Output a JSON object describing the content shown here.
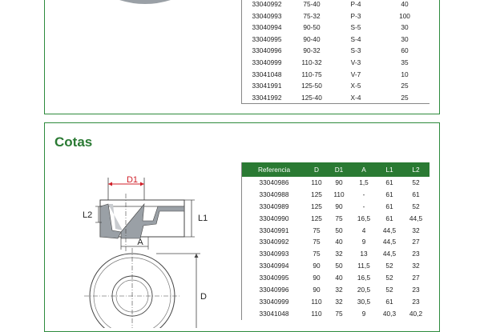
{
  "top_table": {
    "rows": [
      [
        "33040992",
        "75-40",
        "P-4",
        "40"
      ],
      [
        "33040993",
        "75-32",
        "P-3",
        "100"
      ],
      [
        "33040994",
        "90-50",
        "S-5",
        "30"
      ],
      [
        "33040995",
        "90-40",
        "S-4",
        "30"
      ],
      [
        "33040996",
        "90-32",
        "S-3",
        "60"
      ],
      [
        "33040999",
        "110-32",
        "V-3",
        "35"
      ],
      [
        "33041048",
        "110-75",
        "V-7",
        "10"
      ],
      [
        "33041991",
        "125-50",
        "X-5",
        "25"
      ],
      [
        "33041992",
        "125-40",
        "X-4",
        "25"
      ]
    ]
  },
  "cotas": {
    "title": "Cotas",
    "drawing_labels": {
      "d1": "D1",
      "l2": "L2",
      "l1": "L1",
      "a": "A",
      "d": "D"
    },
    "table": {
      "headers": [
        "Referencia",
        "D",
        "D1",
        "A",
        "L1",
        "L2"
      ],
      "rows": [
        [
          "33040986",
          "110",
          "90",
          "1,5",
          "61",
          "52"
        ],
        [
          "33040988",
          "125",
          "110",
          "-",
          "61",
          "61"
        ],
        [
          "33040989",
          "125",
          "90",
          "-",
          "61",
          "52"
        ],
        [
          "33040990",
          "125",
          "75",
          "16,5",
          "61",
          "44,5"
        ],
        [
          "33040991",
          "75",
          "50",
          "4",
          "44,5",
          "32"
        ],
        [
          "33040992",
          "75",
          "40",
          "9",
          "44,5",
          "27"
        ],
        [
          "33040993",
          "75",
          "32",
          "13",
          "44,5",
          "23"
        ],
        [
          "33040994",
          "90",
          "50",
          "11,5",
          "52",
          "32"
        ],
        [
          "33040995",
          "90",
          "40",
          "16,5",
          "52",
          "27"
        ],
        [
          "33040996",
          "90",
          "32",
          "20,5",
          "52",
          "23"
        ],
        [
          "33040999",
          "110",
          "32",
          "30,5",
          "61",
          "23"
        ],
        [
          "33041048",
          "110",
          "75",
          "9",
          "40,3",
          "40,2"
        ]
      ]
    }
  },
  "colors": {
    "accent": "#2a7a33",
    "frame": "#2e8b3d",
    "dim_red": "#d0202a"
  }
}
